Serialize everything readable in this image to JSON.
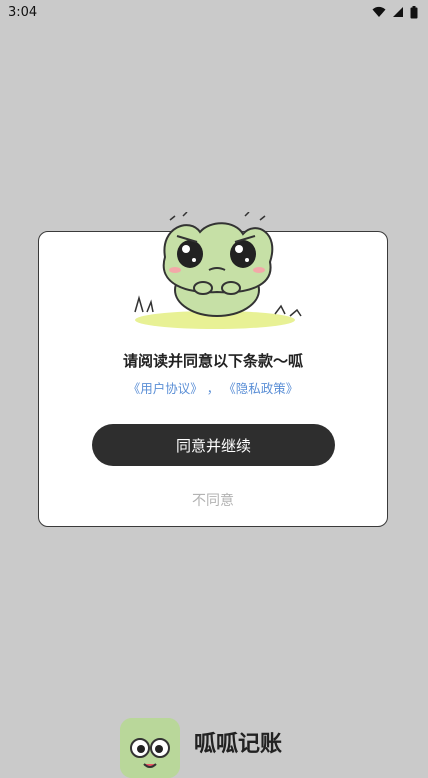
{
  "status_bar": {
    "time": "3:04"
  },
  "dialog": {
    "title": "请阅读并同意以下条款～呱",
    "user_agreement": "《用户协议》",
    "separator": "，",
    "privacy_policy": "《隐私政策》",
    "agree_button": "同意并继续",
    "disagree_button": "不同意"
  },
  "app": {
    "name": "呱呱记账"
  },
  "colors": {
    "link": "#5b8fd6",
    "button": "#2e2e2e",
    "overlay": "#cacaca",
    "frog": "#c6e0a6"
  },
  "icons": {
    "wifi": "wifi-icon",
    "signal": "signal-icon",
    "battery": "battery-icon",
    "mascot": "frog-mascot-icon"
  }
}
